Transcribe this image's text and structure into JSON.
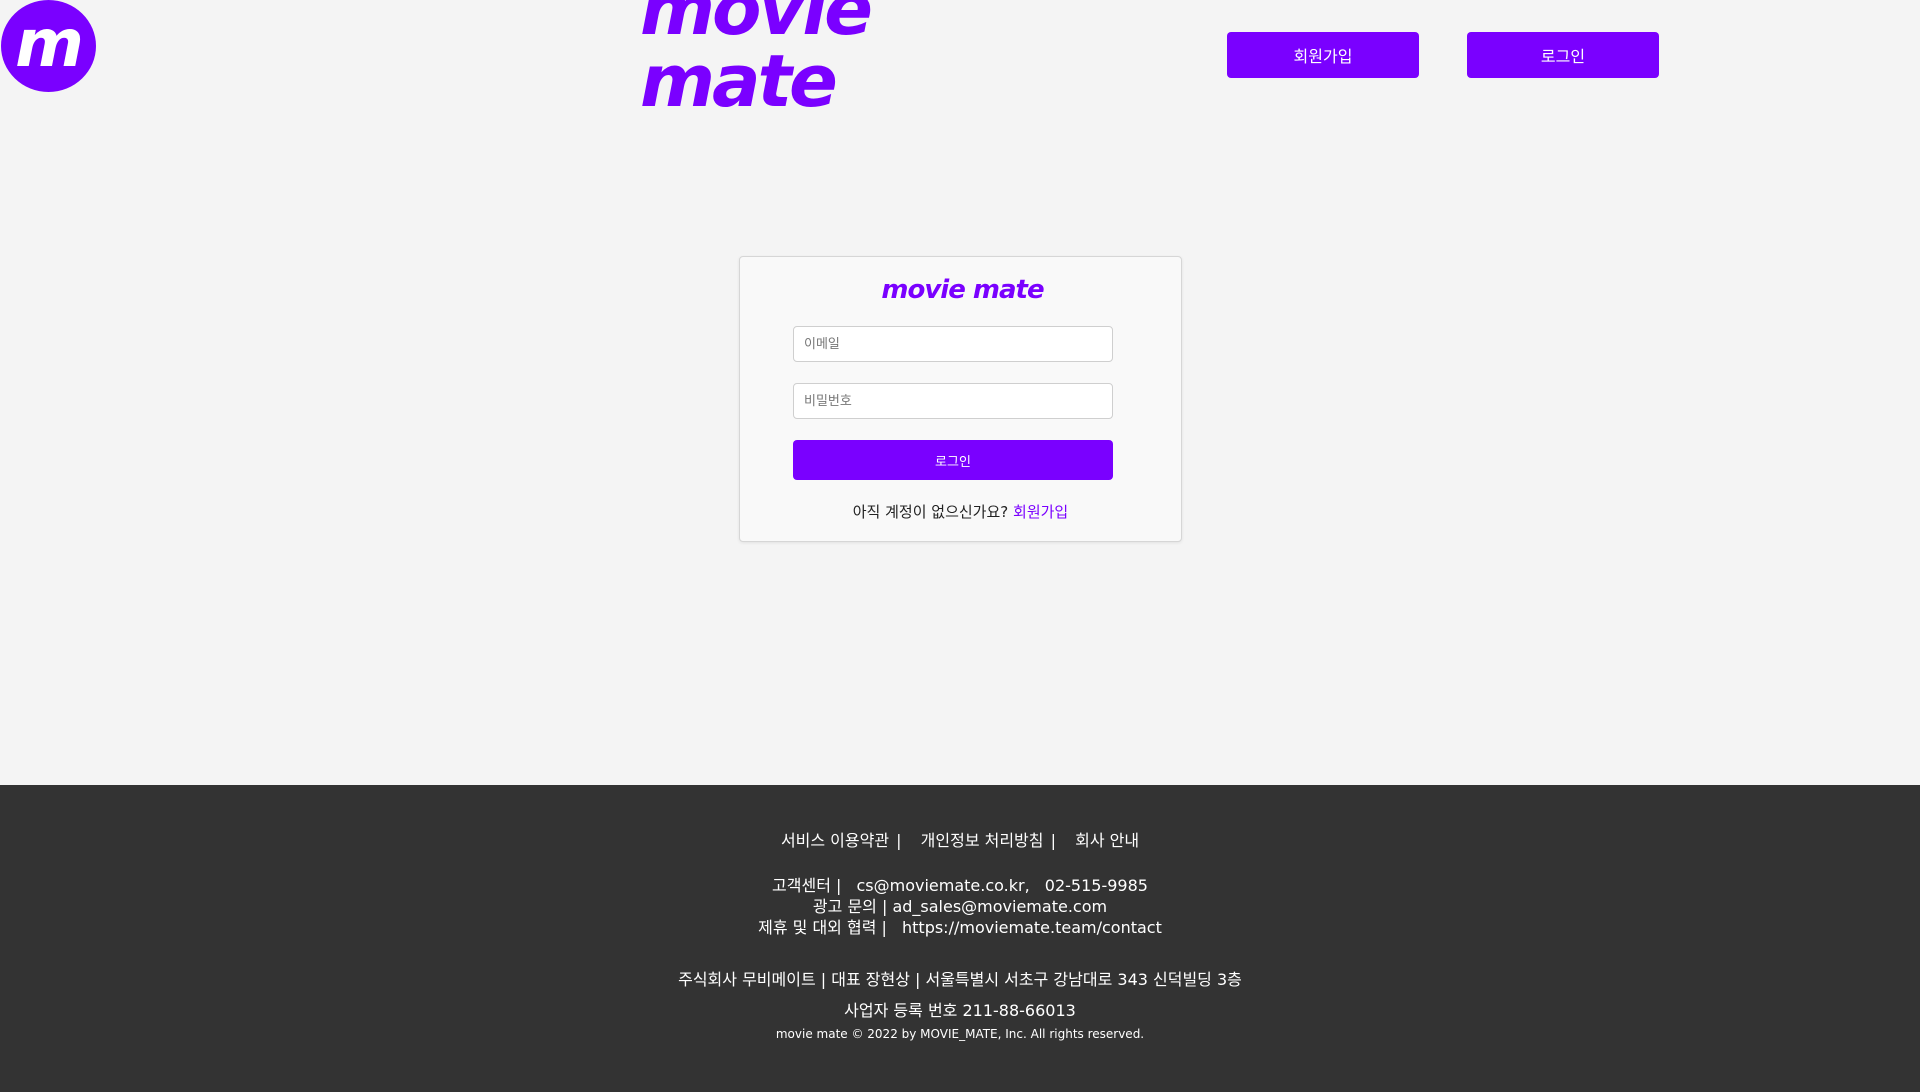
{
  "header": {
    "logo_letter": "m",
    "wordmark": "movie mate",
    "signup_label": "회원가입",
    "login_label": "로그인"
  },
  "login_card": {
    "logo": "movie mate",
    "email_placeholder": "이메일",
    "password_placeholder": "비밀번호",
    "login_button": "로그인",
    "no_account_text": "아직 계정이 없으신가요?",
    "signup_link": "회원가입"
  },
  "footer": {
    "links": [
      {
        "label": "서비스 이용약관",
        "sep": "|"
      },
      {
        "label": "개인정보 처리방침",
        "sep": "|"
      },
      {
        "label": "회사 안내"
      }
    ],
    "customer_center_label": "고객센터 |",
    "customer_email": "cs@moviemate.co.kr,",
    "customer_phone": "02-515-9985",
    "ad_inquiry": "광고 문의 | ad_sales@moviemate.com",
    "partnership_label": "제휴 및 대외 협력 |",
    "partnership_url": "https://moviemate.team/contact",
    "company_info": "주식회사 무비메이트 | 대표 장현상 | 서울특별시 서초구 강남대로 343 신덕빌딩 3층",
    "business_number": "사업자 등록 번호 211-88-66013",
    "copyright": "movie mate © 2022 by MOVIE_MATE, Inc. All rights reserved."
  },
  "colors": {
    "accent": "#7a00ff",
    "page_bg": "#f4f4f4",
    "footer_bg": "#333333"
  }
}
